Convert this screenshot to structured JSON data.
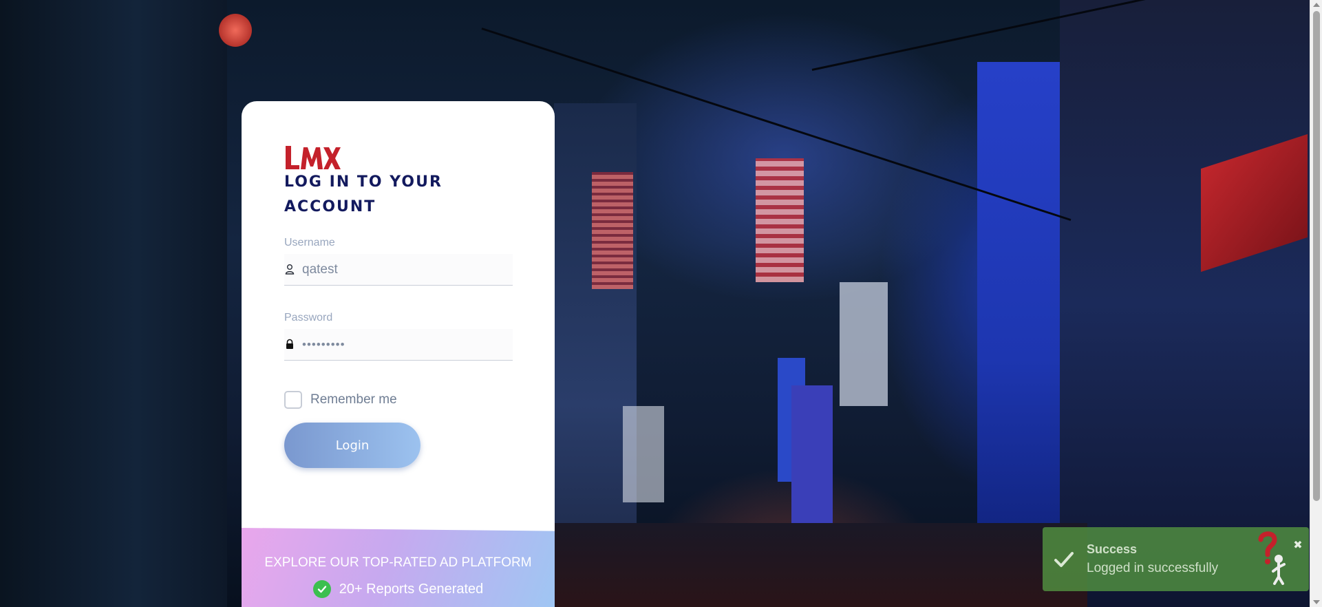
{
  "login": {
    "title_line1": "LOG IN TO YOUR",
    "title_line2": "ACCOUNT",
    "username_label": "Username",
    "username_value": "qatest",
    "password_label": "Password",
    "password_value": "•••••••••",
    "remember_label": "Remember me",
    "remember_checked": false,
    "login_button": "Login"
  },
  "promo": {
    "title": "EXPLORE OUR TOP-RATED AD PLATFORM",
    "item": "20+ Reports Generated"
  },
  "toast": {
    "title": "Success",
    "message": "Logged in successfully",
    "close": "✖"
  },
  "icons": {
    "logo": "lmx-logo",
    "username": "user-icon",
    "password": "lock-icon",
    "promo_check": "check-circle-icon",
    "toast_check": "check-icon",
    "toast_close": "close-icon",
    "help": "help-mascot-icon"
  },
  "colors": {
    "brand_red": "#c4212b",
    "title_navy": "#131a5e",
    "button_gradient_start": "#7a98cf",
    "button_gradient_end": "#9cc2ef",
    "toast_green": "#529141",
    "promo_check_green": "#3cbf4f"
  }
}
